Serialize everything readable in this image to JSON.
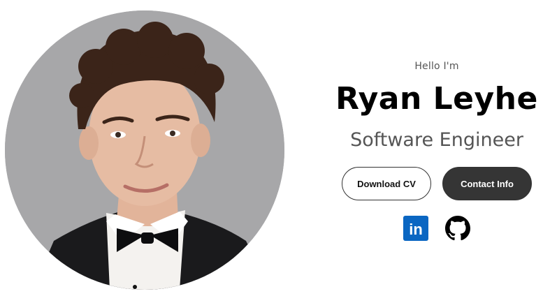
{
  "profile": {
    "greeting": "Hello I'm",
    "name": "Ryan Leyhe",
    "role": "Software Engineer",
    "portrait": "profile-photo"
  },
  "buttons": {
    "download_cv": "Download CV",
    "contact_info": "Contact Info"
  },
  "social": [
    {
      "icon": "linkedin-icon",
      "label": "in",
      "color": "#0a66c2"
    },
    {
      "icon": "github-icon",
      "color": "#000000"
    }
  ],
  "colors": {
    "portrait_bg": "#a7a7a9",
    "primary_button": "#353535"
  }
}
